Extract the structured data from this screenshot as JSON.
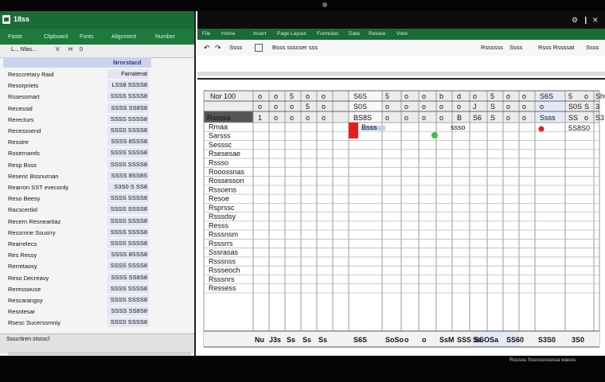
{
  "left_window": {
    "app_title": "18ss",
    "ribbon_items": [
      "Paste",
      "Clipboard",
      "Fonts",
      "Alignment",
      "Number"
    ],
    "header": {
      "col1": "L... Nfas...",
      "col2": "V",
      "col3": "H",
      "col4": "0"
    },
    "selected_value": "Nrnrstacd",
    "rows": [
      {
        "name": "Resccretary Raid",
        "value": "Farraterat"
      },
      {
        "name": "Resorpriets",
        "value": "LSS8 SSSS8"
      },
      {
        "name": "Rssessmart",
        "value": "SSSS SSSS8"
      },
      {
        "name": "Recessid",
        "value": "SSSS SS8S8"
      },
      {
        "name": "Rerecturs",
        "value": "SSSS SSSS8"
      },
      {
        "name": "Recesssend",
        "value": "SSSS SSSS8"
      },
      {
        "name": "Resstre",
        "value": "SSSS 8SSS8"
      },
      {
        "name": "Rosernarelc",
        "value": "SSSS SSSS8"
      },
      {
        "name": "Resp Bsss",
        "value": "SSSS SSSS8"
      },
      {
        "name": "Resenc Bssnurnan",
        "value": "SSSS 8SS8S"
      },
      {
        "name": "Rearron SST evecordy",
        "value": "S3S0 S SS8"
      },
      {
        "name": "Reso Beesy",
        "value": "SSSS SSSS8"
      },
      {
        "name": "Racscertiol",
        "value": "SSSS SSSS8"
      },
      {
        "name": "Recern Resneartiaz",
        "value": "SSSS SSSS8"
      },
      {
        "name": "Ressrnne Ssusrry",
        "value": "SSSS SSSS8"
      },
      {
        "name": "Rearrelecs",
        "value": "SSSS SSSS8"
      },
      {
        "name": "Res Ressy",
        "value": "SSSS 8SSS8"
      },
      {
        "name": "Rerretaosy",
        "value": "SSSS SSSS8"
      },
      {
        "name": "Reso Decreavy",
        "value": "SSSS SS8S8"
      },
      {
        "name": "Reresswuse",
        "value": "SSSS SSSS8"
      },
      {
        "name": "Rescarangsy",
        "value": "SSSS SSSS8"
      },
      {
        "name": "Resntesar",
        "value": "SSSS SS8S8"
      },
      {
        "name": "Rsesc Sucerssmniy",
        "value": "SSSS SSSS8"
      }
    ],
    "footer": "Ssscrtiren stssscl"
  },
  "right_window": {
    "title_controls": [
      "⚙",
      "❙",
      "✕"
    ],
    "ribbon_items": [
      "File",
      "Home",
      "Insert",
      "Page Layout",
      "Formulas",
      "Data",
      "Review",
      "View"
    ],
    "toolbar": {
      "undo": "↶",
      "redo": "↷",
      "paste": "Ssss",
      "format": "Bsss ssscser sss",
      "right1": "Rssssss",
      "right2": "Ssss",
      "right3": "Rsss Rssssat",
      "right4": "Ssss"
    },
    "grid": {
      "corner_label": "Nor 100",
      "head_label": "Rssssa",
      "header_row1": [
        "o",
        "o",
        "5",
        "o",
        "o",
        "S6S",
        "5",
        "o",
        "o",
        "b",
        "d",
        "o",
        "5",
        "o",
        "o",
        "S6S",
        "5",
        "o",
        "Sh6",
        "5S"
      ],
      "header_row2": [
        "o",
        "o",
        "o",
        "5",
        "o",
        "S0S",
        "o",
        "o",
        "o",
        "o",
        "o",
        "J",
        "S",
        "o",
        "o",
        "o",
        "S0S",
        "S",
        "3"
      ],
      "header_row3": [
        "1",
        "o",
        "o",
        "o",
        "o",
        "BS8S",
        "o",
        "o",
        "o",
        "o",
        "B",
        "S6",
        "S",
        "o",
        "o",
        "Ssss",
        "SS",
        "o",
        "S3"
      ],
      "row_labels": [
        "Rmaa",
        "Sarsss",
        "Sesssc",
        "Rsesesae",
        "Rssso",
        "Rooossnas",
        "Rossesson",
        "Rssoens",
        "Resoe",
        "Rsprssc",
        "Rsssdsy",
        "Resss",
        "Rsssnsm",
        "Rsssrrs",
        "Sssrasas",
        "Rsssnss",
        "Rssseoch",
        "Rsssnrs",
        "Ressess"
      ],
      "data_cells": {
        "c1": "Bsss",
        "c2": "ssso",
        "c3": "5S8S0"
      },
      "bottom_labels": [
        "Nu",
        "J3s",
        "Ss",
        "Ss",
        "Ss",
        "S6S",
        "SoSo",
        "o",
        "o",
        "SsM",
        "SSS",
        "Ss",
        "SSOSa",
        "SS60",
        "S3S0",
        "3S0"
      ],
      "status_text": "Rsssss Ssscsssssssa wasss"
    }
  },
  "colors": {
    "excel_green": "#1a6b35",
    "excel_green_light": "#1d7a3c",
    "header_blue": "#c9d4ec",
    "alert_red": "#e02020",
    "marker_green": "#3cc03c",
    "grid_line": "#9a9a9a"
  }
}
